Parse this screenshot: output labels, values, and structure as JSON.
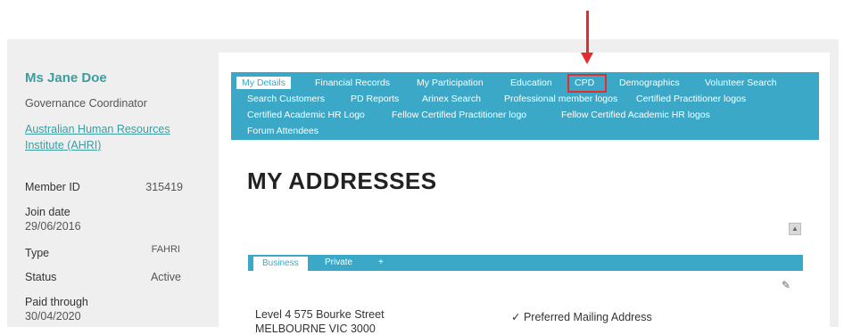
{
  "profile": {
    "name": "Ms Jane Doe",
    "role": "Governance Coordinator",
    "organisation": "Australian Human Resources Institute (AHRI)"
  },
  "details": {
    "member_id_label": "Member ID",
    "member_id": "315419",
    "join_date_label": "Join date",
    "join_date": "29/06/2016",
    "type_label": "Type",
    "type": "FAHRI",
    "status_label": "Status",
    "status": "Active",
    "paid_through_label": "Paid through",
    "paid_through": "30/04/2020"
  },
  "nav": {
    "items": [
      "My Details",
      "Financial Records",
      "My Participation",
      "Education",
      "CPD",
      "Demographics",
      "Volunteer Search",
      "Search Customers",
      "PD Reports",
      "Arinex Search",
      "Professional member logos",
      "Certified Practitioner logos",
      "Certified Academic HR Logo",
      "Fellow Certified Practitioner logo",
      "Fellow Certified Academic HR logos",
      "Forum Attendees"
    ],
    "active_index": 0,
    "highlighted_index": 4
  },
  "main": {
    "heading": "MY ADDRESSES",
    "collapse_icon": "▲",
    "tabs": [
      "Business",
      "Private",
      "+"
    ],
    "active_tab": 0,
    "address_line1": "Level 4 575 Bourke Street",
    "address_line2": "MELBOURNE VIC 3000",
    "preferred": "✓ Preferred Mailing Address",
    "edit_icon": "✎"
  },
  "colors": {
    "accent": "#3aa8c6",
    "brand_text": "#3d9ca0",
    "annotation": "#e52b2b"
  }
}
